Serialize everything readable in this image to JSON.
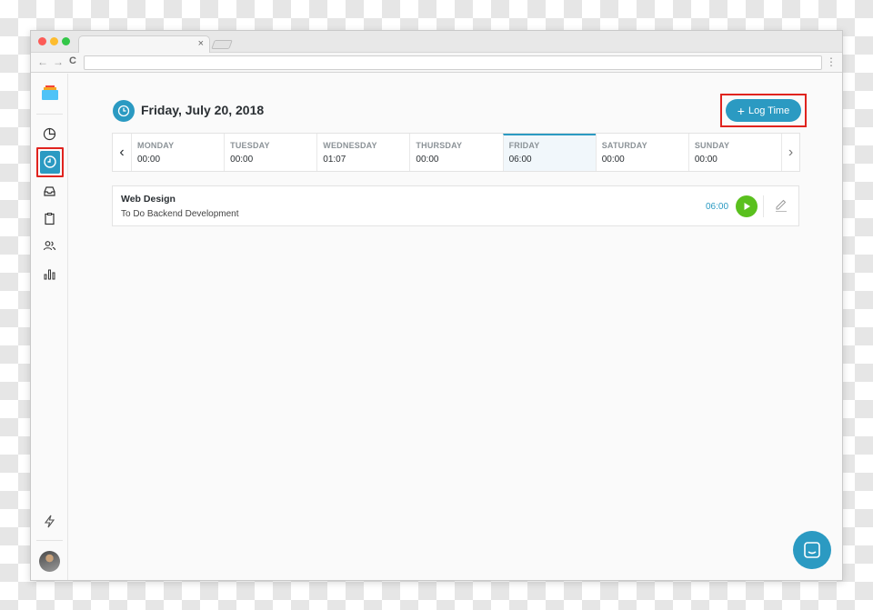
{
  "browser": {
    "tab_close": "×",
    "back": "←",
    "forward": "→",
    "reload": "C",
    "menu": "⋮"
  },
  "sidebar": {
    "logo": "app-logo",
    "items": [
      {
        "icon": "pie-chart-icon",
        "active": false
      },
      {
        "icon": "clock-icon",
        "active": true
      },
      {
        "icon": "inbox-icon",
        "active": false
      },
      {
        "icon": "clipboard-icon",
        "active": false
      },
      {
        "icon": "users-icon",
        "active": false
      },
      {
        "icon": "bar-chart-icon",
        "active": false
      }
    ],
    "bottom": [
      {
        "icon": "lightning-icon"
      },
      {
        "icon": "avatar"
      }
    ]
  },
  "header": {
    "title": "Friday, July 20, 2018",
    "log_time_label": "Log Time",
    "log_time_icon": "+"
  },
  "week": {
    "prev": "‹",
    "next": "›",
    "days": [
      {
        "name": "MONDAY",
        "time": "00:00"
      },
      {
        "name": "TUESDAY",
        "time": "00:00"
      },
      {
        "name": "WEDNESDAY",
        "time": "01:07"
      },
      {
        "name": "THURSDAY",
        "time": "00:00"
      },
      {
        "name": "FRIDAY",
        "time": "06:00"
      },
      {
        "name": "SATURDAY",
        "time": "00:00"
      },
      {
        "name": "SUNDAY",
        "time": "00:00"
      }
    ],
    "active_index": 4
  },
  "entries": [
    {
      "project": "Web Design",
      "task": "To Do Backend Development",
      "time": "06:00"
    }
  ],
  "colors": {
    "accent": "#2b9ac2",
    "play": "#5ac01e",
    "highlight": "#e0231e"
  }
}
